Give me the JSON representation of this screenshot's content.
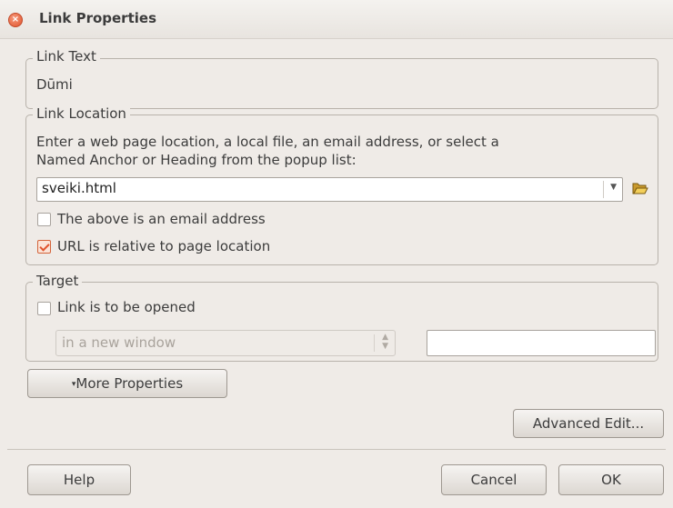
{
  "window": {
    "title": "Link Properties"
  },
  "link_text": {
    "legend": "Link Text",
    "value": "Dūmi"
  },
  "link_location": {
    "legend": "Link Location",
    "instructions_line1": "Enter a web page location, a local file, an email address, or select a",
    "instructions_line2": "Named Anchor or Heading from the popup list:",
    "url_value": "sveiki.html",
    "email_checkbox_label": "The above is an email address",
    "email_checked": false,
    "relative_checkbox_label": "URL is relative to page location",
    "relative_checked": true
  },
  "target": {
    "legend": "Target",
    "open_checkbox_label": "Link is to be opened",
    "open_checked": false,
    "window_select_value": "in a new window",
    "target_name_value": ""
  },
  "buttons": {
    "more_properties": "More Properties",
    "advanced_edit": "Advanced Edit...",
    "help": "Help",
    "cancel": "Cancel",
    "ok": "OK"
  },
  "colors": {
    "accent": "#e0532c",
    "background": "#efebe7"
  },
  "icons": {
    "close": "close-icon",
    "browse": "folder-open-icon"
  }
}
